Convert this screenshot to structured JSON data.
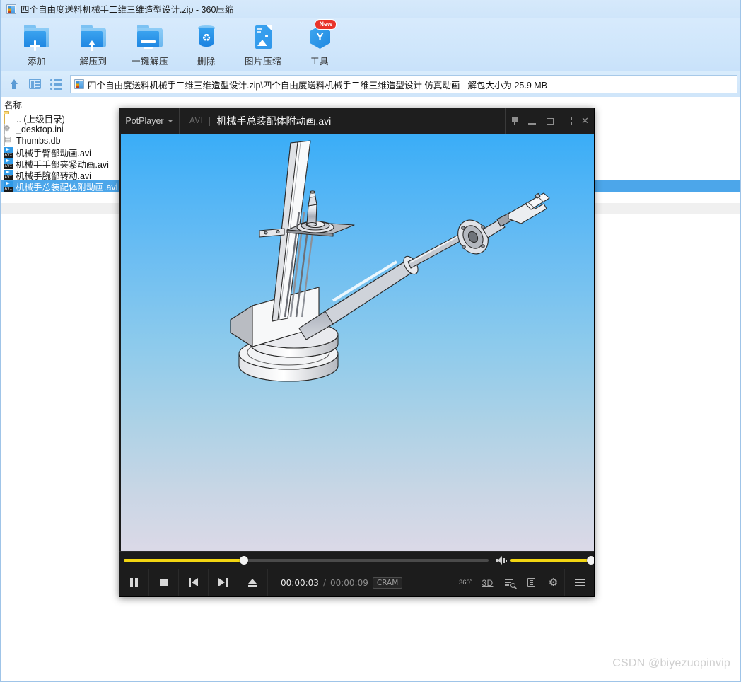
{
  "window": {
    "title": "四个自由度送料机械手二维三维造型设计.zip - 360压缩",
    "app_icon": "zip-archive-icon"
  },
  "toolbar": {
    "buttons": [
      {
        "label": "添加",
        "icon": "folder-add-icon",
        "badge": ""
      },
      {
        "label": "解压到",
        "icon": "folder-extract-icon",
        "badge": ""
      },
      {
        "label": "一键解压",
        "icon": "folder-oneclick-extract-icon",
        "badge": ""
      },
      {
        "label": "删除",
        "icon": "recycle-bin-icon",
        "badge": ""
      },
      {
        "label": "图片压缩",
        "icon": "image-compress-icon",
        "badge": ""
      },
      {
        "label": "工具",
        "icon": "tools-hexagon-icon",
        "badge": "New"
      }
    ]
  },
  "pathbar": {
    "up_icon": "up-arrow-icon",
    "pane_icon": "preview-pane-icon",
    "list_icon": "list-view-icon",
    "path": "四个自由度送料机械手二维三维造型设计.zip\\四个自由度送料机械手二维三维造型设计 仿真动画 - 解包大小为 25.9 MB"
  },
  "filelist": {
    "column_header": "名称",
    "rows": [
      {
        "name": ".. (上级目录)",
        "icon": "folder-up-icon",
        "selected": false
      },
      {
        "name": "_desktop.ini",
        "icon": "ini-file-icon",
        "selected": false
      },
      {
        "name": "Thumbs.db",
        "icon": "thumbs-db-icon",
        "selected": false
      },
      {
        "name": "机械手臂部动画.avi",
        "icon": "avi-file-icon",
        "selected": false
      },
      {
        "name": "机械手手部夹紧动画.avi",
        "icon": "avi-file-icon",
        "selected": false
      },
      {
        "name": "机械手腕部转动.avi",
        "icon": "avi-file-icon",
        "selected": false
      },
      {
        "name": "机械手总装配体附动画.avi",
        "icon": "avi-file-icon",
        "selected": true
      }
    ]
  },
  "potplayer": {
    "brand": "PotPlayer",
    "file_type": "AVI",
    "filename": "机械手总装配体附动画.avi",
    "window_buttons": [
      {
        "name": "pin-icon",
        "label": ""
      },
      {
        "name": "minimize-icon",
        "label": ""
      },
      {
        "name": "maximize-icon",
        "label": ""
      },
      {
        "name": "fullscreen-icon",
        "label": ""
      },
      {
        "name": "close-icon",
        "label": "✕"
      }
    ],
    "seek": {
      "percent": 33,
      "fill_color": "#f2d512"
    },
    "volume": {
      "percent": 100,
      "fill_color": "#f2d512"
    },
    "transport": [
      {
        "name": "pause-button",
        "icon": "pause-icon"
      },
      {
        "name": "stop-button",
        "icon": "stop-icon"
      },
      {
        "name": "previous-button",
        "icon": "previous-track-icon"
      },
      {
        "name": "next-button",
        "icon": "next-track-icon"
      },
      {
        "name": "eject-button",
        "icon": "eject-icon"
      }
    ],
    "time": {
      "current": "00:00:03",
      "separator": "/",
      "total": "00:00:09",
      "codec": "CRAM"
    },
    "right_tools": [
      {
        "name": "vr360-button",
        "label": "360˚"
      },
      {
        "name": "3d-button",
        "label": "3D"
      },
      {
        "name": "playlist-search-button",
        "label": ""
      },
      {
        "name": "playlist-button",
        "label": ""
      },
      {
        "name": "preferences-button",
        "label": "⚙"
      },
      {
        "name": "menu-button",
        "label": ""
      }
    ],
    "video": {
      "description": "四自由度送料机械手三维装配体仿真动画",
      "background_top": "#3aadf7",
      "background_bottom": "#dbd9e7"
    }
  },
  "watermark": "CSDN @biyezuopinvip"
}
